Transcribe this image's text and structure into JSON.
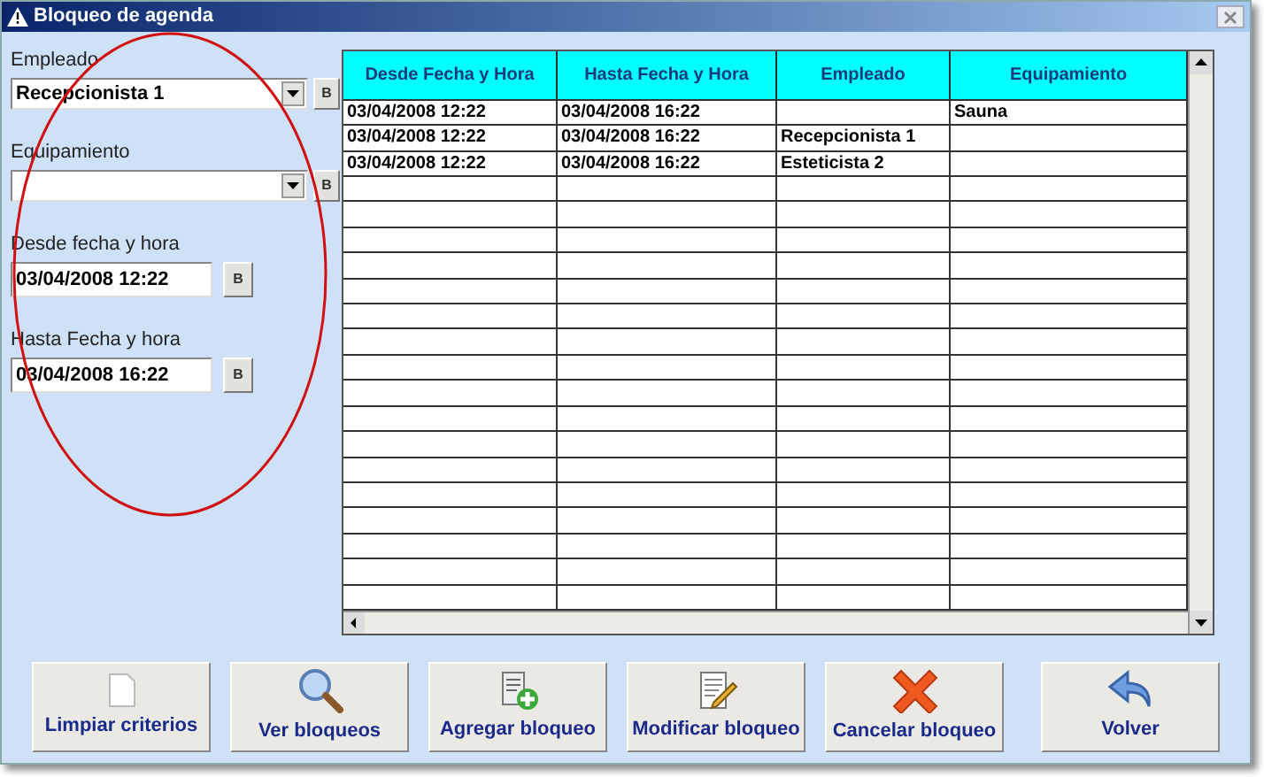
{
  "window": {
    "title": "Bloqueo de agenda"
  },
  "filters": [
    {
      "label": "Empleado",
      "kind": "select",
      "value": "Recepcionista 1",
      "button": "B"
    },
    {
      "label": "Equipamiento",
      "kind": "select",
      "button": "B"
    },
    {
      "label": "Desde fecha y hora",
      "kind": "date",
      "value": "03/04/2008 12:22",
      "button": "B"
    },
    {
      "label": "Hasta Fecha y hora",
      "kind": "date",
      "value": "03/04/2008 16:22",
      "button": "B"
    }
  ],
  "table": {
    "columns": [
      "Desde Fecha y Hora",
      "Hasta Fecha y Hora",
      "Empleado",
      "Equipamiento"
    ],
    "rows": [
      [
        "03/04/2008 12:22",
        "03/04/2008 16:22",
        "",
        "Sauna"
      ],
      [
        "03/04/2008 12:22",
        "03/04/2008 16:22",
        "Recepcionista 1",
        ""
      ],
      [
        "03/04/2008 12:22",
        "03/04/2008 16:22",
        "Esteticista 2",
        ""
      ]
    ]
  },
  "buttons": [
    {
      "label": "Limpiar criterios",
      "kind": "clear"
    },
    {
      "label": "Ver bloqueos",
      "kind": "view"
    },
    {
      "label": "Agregar bloqueo",
      "kind": "add"
    },
    {
      "label": "Modificar bloqueo",
      "kind": "edit"
    },
    {
      "label": "Cancelar bloqueo",
      "kind": "cancel"
    },
    {
      "label": "Volver",
      "kind": "back"
    }
  ]
}
